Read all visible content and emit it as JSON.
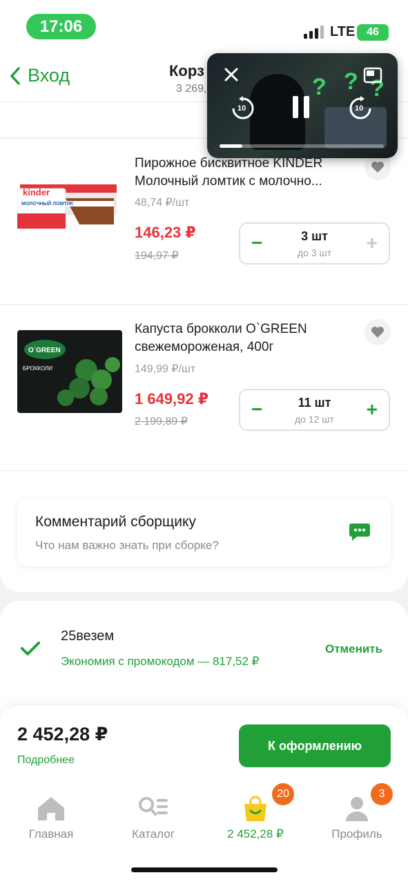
{
  "status_bar": {
    "time": "17:06",
    "network": "LTE",
    "battery": "46"
  },
  "header": {
    "back_label": "Вход",
    "title": "Корз",
    "subtitle": "3 269,"
  },
  "cart_items": [
    {
      "name_line1": "Пирожное бисквитное KINDER",
      "name_line2": "Молочный ломтик с молочно...",
      "unit_price": "48,74 ₽/шт",
      "price": "146,23 ₽",
      "old_price": "194,97 ₽",
      "quantity": "3 шт",
      "limit": "до 3 шт",
      "image_brand": "kinder",
      "image_title": "МОЛОЧНЫЙ ЛОМТИК"
    },
    {
      "name_line1": "Капуста брокколи O`GREEN",
      "name_line2": "свежемороженая, 400г",
      "unit_price": "149,99 ₽/шт",
      "price": "1 649,92 ₽",
      "old_price": "2 199,89 ₽",
      "quantity": "11 шт",
      "limit": "до 12 шт",
      "image_brand": "O`GREEN",
      "image_title": "БРОККОЛИ"
    }
  ],
  "comment": {
    "title": "Комментарий сборщику",
    "placeholder": "Что нам важно знать при сборке?"
  },
  "promo": {
    "code": "25везем",
    "savings": "Экономия с промокодом — 817,52 ₽",
    "cancel_label": "Отменить"
  },
  "checkout": {
    "total": "2 452,28 ₽",
    "details_label": "Подробнее",
    "button_label": "К оформлению"
  },
  "tabs": [
    {
      "label": "Главная",
      "icon": "home-icon"
    },
    {
      "label": "Каталог",
      "icon": "catalog-search-icon"
    },
    {
      "label": "2 452,28 ₽",
      "icon": "cart-bag-icon",
      "badge": "20"
    },
    {
      "label": "Профиль",
      "icon": "profile-icon",
      "badge": "3"
    }
  ],
  "pip": {
    "skip_seconds": "10",
    "progress": 0.14
  },
  "colors": {
    "accent": "#21a038",
    "price_red": "#e5333b",
    "badge_orange": "#f26b1d",
    "status_green": "#34c759"
  }
}
